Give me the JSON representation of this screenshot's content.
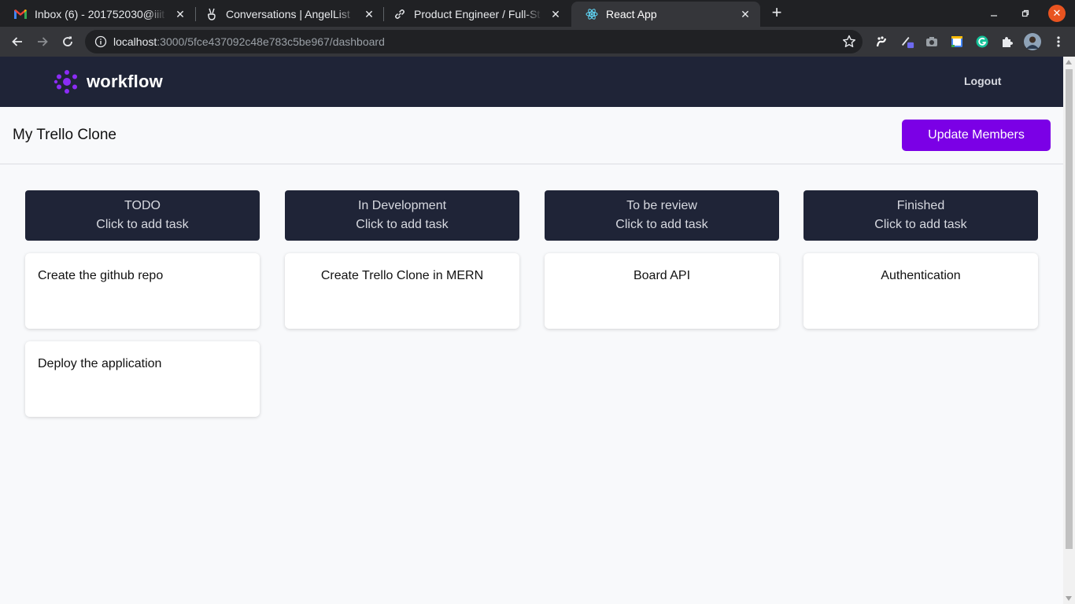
{
  "browser": {
    "tabs": [
      {
        "title": "Inbox (6) - 201752030@iiit",
        "icon": "gmail-icon"
      },
      {
        "title": "Conversations | AngelList",
        "icon": "angellist-icon"
      },
      {
        "title": "Product Engineer / Full-St",
        "icon": "link-icon"
      },
      {
        "title": "React App",
        "icon": "react-icon",
        "active": true
      }
    ],
    "url_host": "localhost",
    "url_rest": ":3000/5fce437092c48e783c5be967/dashboard"
  },
  "header": {
    "logo_text": "workflow",
    "logout_label": "Logout"
  },
  "board": {
    "title": "My Trello Clone",
    "update_members_label": "Update Members"
  },
  "columns": [
    {
      "name": "TODO",
      "add_label": "Click to add task",
      "cards": [
        "Create the github repo",
        "Deploy the application"
      ]
    },
    {
      "name": "In Development",
      "add_label": "Click to add task",
      "cards": [
        "Create Trello Clone in MERN"
      ]
    },
    {
      "name": "To be review",
      "add_label": "Click to add task",
      "cards": [
        "Board API"
      ]
    },
    {
      "name": "Finished",
      "add_label": "Click to add task",
      "cards": [
        "Authentication"
      ]
    }
  ],
  "colors": {
    "header_bg": "#1f2437",
    "accent": "#7b00e6",
    "page_bg": "#f8f9fb"
  }
}
